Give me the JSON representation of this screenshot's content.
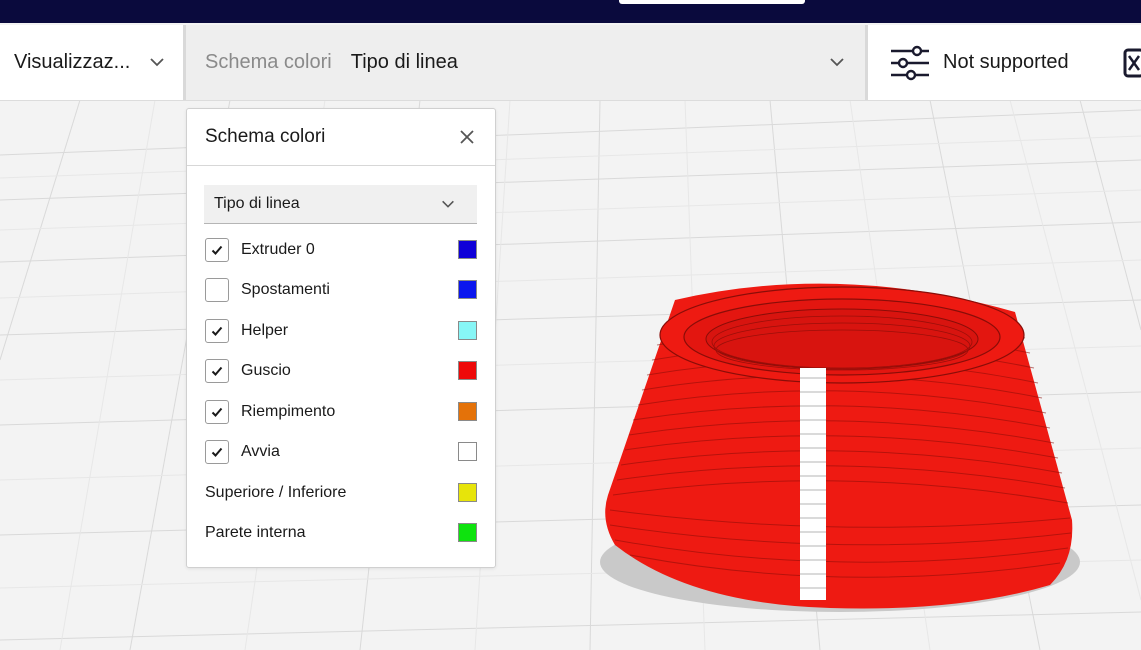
{
  "toolbar": {
    "view_label": "Visualizzaz...",
    "scheme_prefix": "Schema colori",
    "scheme_value": "Tipo di linea",
    "support_label": "Not supported"
  },
  "panel": {
    "title": "Schema colori",
    "dropdown_value": "Tipo di linea",
    "items": [
      {
        "label": "Extruder 0",
        "checkbox": true,
        "checked": true,
        "color": "#0f00d8"
      },
      {
        "label": "Spostamenti",
        "checkbox": true,
        "checked": false,
        "color": "#0b16ee"
      },
      {
        "label": "Helper",
        "checkbox": true,
        "checked": true,
        "color": "#87f6f6"
      },
      {
        "label": "Guscio",
        "checkbox": true,
        "checked": true,
        "color": "#ee0909"
      },
      {
        "label": "Riempimento",
        "checkbox": true,
        "checked": true,
        "color": "#e47209"
      },
      {
        "label": "Avvia",
        "checkbox": true,
        "checked": true,
        "color": "#ffffff"
      },
      {
        "label": "Superiore / Inferiore",
        "checkbox": false,
        "color": "#e7e40a"
      },
      {
        "label": "Parete interna",
        "checkbox": false,
        "color": "#0ee30e"
      }
    ]
  },
  "icons": {
    "view_chevron": "chevron-down-icon",
    "scheme_chevron": "chevron-down-icon",
    "support": "sliders-icon",
    "close": "close-icon",
    "check": "check-icon",
    "cube": "support-blocker-icon"
  },
  "colors": {
    "topbar": "#0a0a3d",
    "model": "#ee1a12"
  }
}
